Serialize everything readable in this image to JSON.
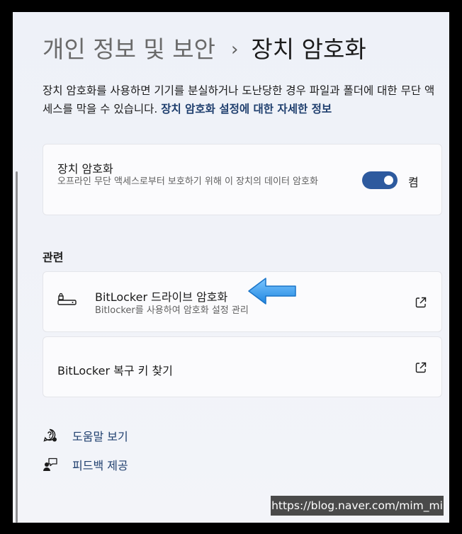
{
  "breadcrumb": {
    "parent": "개인 정보 및 보안",
    "separator": "›",
    "current": "장치 암호화"
  },
  "description": {
    "text": "장치 암호화를 사용하면 기기를 분실하거나 도난당한 경우 파일과 폴더에 대한 무단 액세스를 막을 수 있습니다. ",
    "link": "장치 암호화 설정에 대한 자세한 정보"
  },
  "device_encryption": {
    "title": "장치 암호화",
    "subtitle": "오프라인 무단 액세스로부터 보호하기 위해 이 장치의 데이터 암호화",
    "toggle_state": "켬",
    "toggle_on": true
  },
  "related": {
    "label": "관련",
    "items": [
      {
        "title": "BitLocker 드라이브 암호화",
        "subtitle": "Bitlocker를 사용하여 암호화 설정 관리",
        "icon": "key-drive-icon"
      },
      {
        "title": "BitLocker 복구 키 찾기",
        "icon": "open-external-icon"
      }
    ]
  },
  "footer_links": [
    {
      "label": "도움말 보기",
      "icon": "help-icon"
    },
    {
      "label": "피드백 제공",
      "icon": "feedback-icon"
    }
  ],
  "watermark": "https://blog.naver.com/mim_mi",
  "colors": {
    "accent": "#2d5a9e",
    "link": "#1f3f6e",
    "arrow": "#3aa0f0"
  }
}
